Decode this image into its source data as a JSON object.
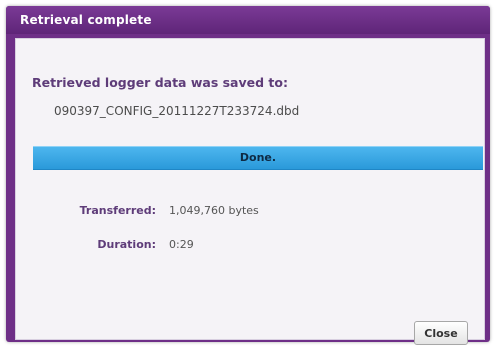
{
  "dialog": {
    "title": "Retrieval complete",
    "saved_message": "Retrieved logger data was saved to:",
    "file_name": "090397_CONFIG_20111227T233724.dbd",
    "progress": {
      "label": "Done.",
      "percent": 100,
      "color": "#33a6e6"
    },
    "stats": [
      {
        "label": "Transferred:",
        "value": "1,049,760 bytes"
      },
      {
        "label": "Duration:",
        "value": "0:29"
      }
    ],
    "close_label": "Close"
  },
  "colors": {
    "title_bar": "#6e2f87",
    "label_text": "#5e3c79",
    "content_background": "#f5f3f7"
  }
}
